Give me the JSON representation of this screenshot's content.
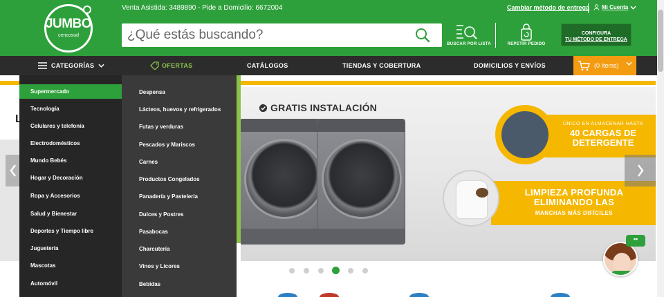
{
  "header": {
    "logo_text": "JUMBO",
    "logo_sub": "cencosud",
    "topinfo": "Venta Asistida: 3489890 - Pide a Domicilio: 6672004",
    "change_method": "Cambiar método de entrega",
    "account": "Mi Cuenta",
    "search_placeholder": "¿Qué estás buscando?",
    "list_button": "BUSCAR POR LISTA",
    "repeat_button": "REPETIR PEDIDO",
    "config_line1": "CONFIGURA",
    "config_line2": "TU MÉTODO DE ENTREGA"
  },
  "nav": {
    "categorias": "CATEGORÍAS",
    "ofertas": "OFERTAS",
    "catalogos": "CATÁLOGOS",
    "tiendas": "TIENDAS Y COBERTURA",
    "domicilios": "DOMICILIOS Y ENVÍOS",
    "cart": "(0 ítems)"
  },
  "menu": {
    "categories": [
      "Supermercado",
      "Tecnología",
      "Celulares y telefonía",
      "Electrodomésticos",
      "Mundo Bebés",
      "Hogar y Decoración",
      "Ropa y Accesorios",
      "Salud y Bienestar",
      "Deportes y Tiempo libre",
      "Juguetería",
      "Mascotas",
      "Automóvil"
    ],
    "subcategories": [
      "Despensa",
      "Lácteos, huevos y refrigerados",
      "Futas y verduras",
      "Pescados y Mariscos",
      "Carnes",
      "Productos Congelados",
      "Panadería y Pastelería",
      "Dulces y Postres",
      "Pasabocas",
      "Charcutería",
      "Vinos y Licores",
      "Bebidas"
    ]
  },
  "banner": {
    "left_letter": "L",
    "gratis": "GRATIS INSTALACIÓN",
    "promo1_small": "ÚNICO EN ALMACENAR HASTA",
    "promo1_big_1": "40 CARGAS DE",
    "promo1_big_2": "DETERGENTE",
    "promo2_big_1": "LIMPIEZA PROFUNDA",
    "promo2_big_2": "ELIMINANDO LAS",
    "promo2_small": "MANCHAS MÁS DIFÍCILES",
    "slide_count": 6,
    "active_slide": 4
  },
  "chat": {
    "bubble": "••"
  },
  "colors": {
    "brand_green": "#2ea03b",
    "dark_nav": "#2c2c2c",
    "accent_orange": "#f39c12",
    "promo_yellow": "#f5b700"
  }
}
